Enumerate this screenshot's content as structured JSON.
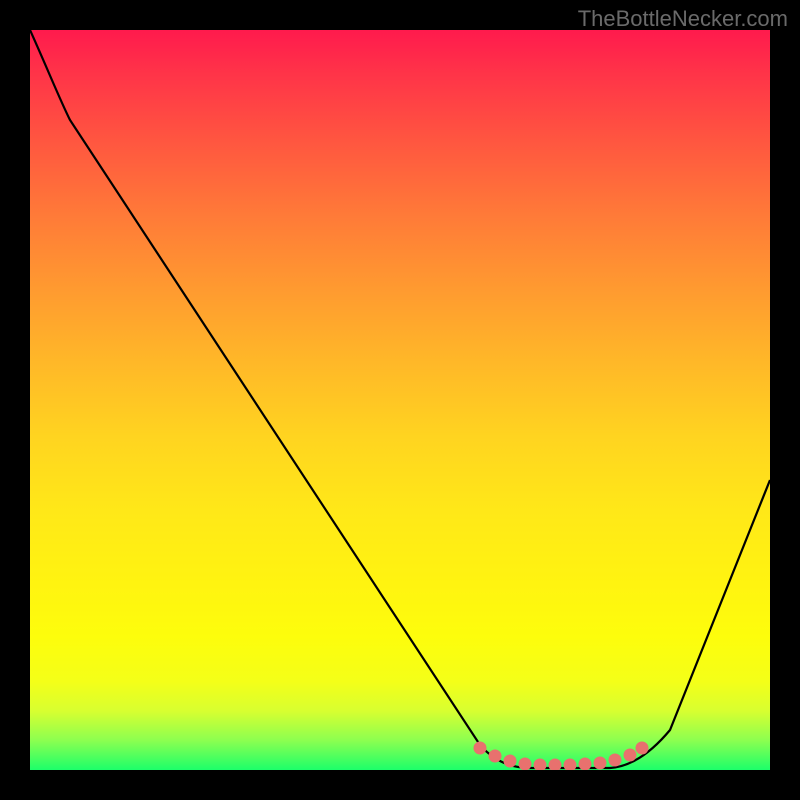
{
  "watermark": "TheBottleNecker.com",
  "chart_data": {
    "type": "line",
    "title": "",
    "xlabel": "",
    "ylabel": "",
    "xlim": [
      0,
      100
    ],
    "ylim": [
      0,
      100
    ],
    "curve": {
      "note": "Values estimated from pixels; x,y in percent of plot area; y=100 is top, y=0 is bottom",
      "x": [
        0,
        5,
        10,
        15,
        20,
        25,
        30,
        35,
        40,
        45,
        50,
        55,
        60,
        62,
        65,
        70,
        75,
        80,
        85,
        90,
        95,
        100
      ],
      "y": [
        100,
        94,
        87,
        79,
        71,
        63,
        55,
        47,
        39,
        31,
        23,
        15,
        7,
        3,
        1,
        0,
        0,
        1,
        4,
        12,
        24,
        40
      ]
    },
    "marker_band": {
      "note": "salmon/pink marker dots along the trough",
      "x_percent_range": [
        60,
        82
      ],
      "y_percent": 1,
      "color": "#e8716e"
    },
    "gradient": {
      "top_color": "#ff1a4d",
      "bottom_color": "#1cff6a"
    }
  }
}
